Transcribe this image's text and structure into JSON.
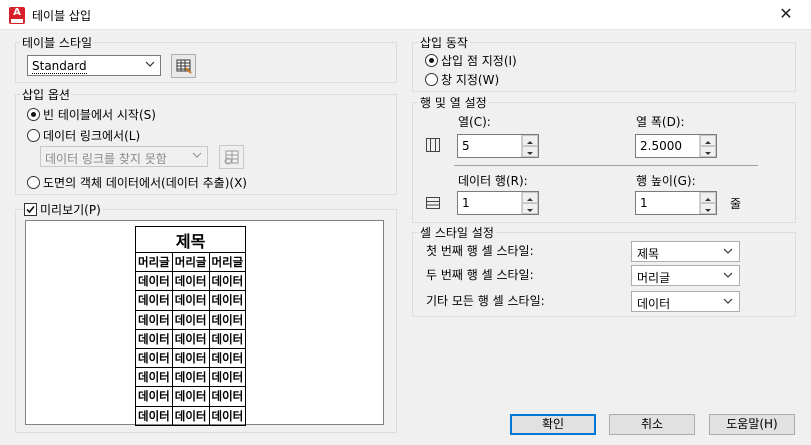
{
  "window": {
    "title": "테이블 삽입",
    "close": "✕"
  },
  "table_style": {
    "label": "테이블 스타일",
    "value": "Standard"
  },
  "insert_options": {
    "label": "삽입 옵션",
    "options": [
      "빈 테이블에서 시작(S)",
      "데이터 링크에서(L)",
      "도면의 객체 데이터에서(데이터 추출)(X)"
    ],
    "selected": 0,
    "datalink_value": "데이터 링크를 찾지 못함"
  },
  "preview": {
    "label": "미리보기(P)",
    "checked": true,
    "table": {
      "title": "제목",
      "header": [
        "머리글",
        "머리글",
        "머리글"
      ],
      "cell": "데이터",
      "data_rows": 8,
      "data_cols": 3
    }
  },
  "insert_behavior": {
    "label": "삽입 동작",
    "options": [
      "삽입 점 지정(I)",
      "창 지정(W)"
    ],
    "selected": 0
  },
  "rows_cols": {
    "label": "행 및 열 설정",
    "columns_label": "열(C):",
    "columns_value": "5",
    "col_width_label": "열 폭(D):",
    "col_width_value": "2.5000",
    "data_rows_label": "데이터 행(R):",
    "data_rows_value": "1",
    "row_height_label": "행 높이(G):",
    "row_height_value": "1",
    "row_height_unit": "줄"
  },
  "cell_styles": {
    "label": "셀 스타일 설정",
    "rows": [
      {
        "label": "첫 번째 행 셀 스타일:",
        "value": "제목"
      },
      {
        "label": "두 번째 행 셀 스타일:",
        "value": "머리글"
      },
      {
        "label": "기타 모든 행 셀 스타일:",
        "value": "데이터"
      }
    ]
  },
  "buttons": {
    "ok": "확인",
    "cancel": "취소",
    "help": "도움말(H)"
  },
  "colors": {
    "accent": "#0078d7",
    "brand": "#d6202a"
  }
}
